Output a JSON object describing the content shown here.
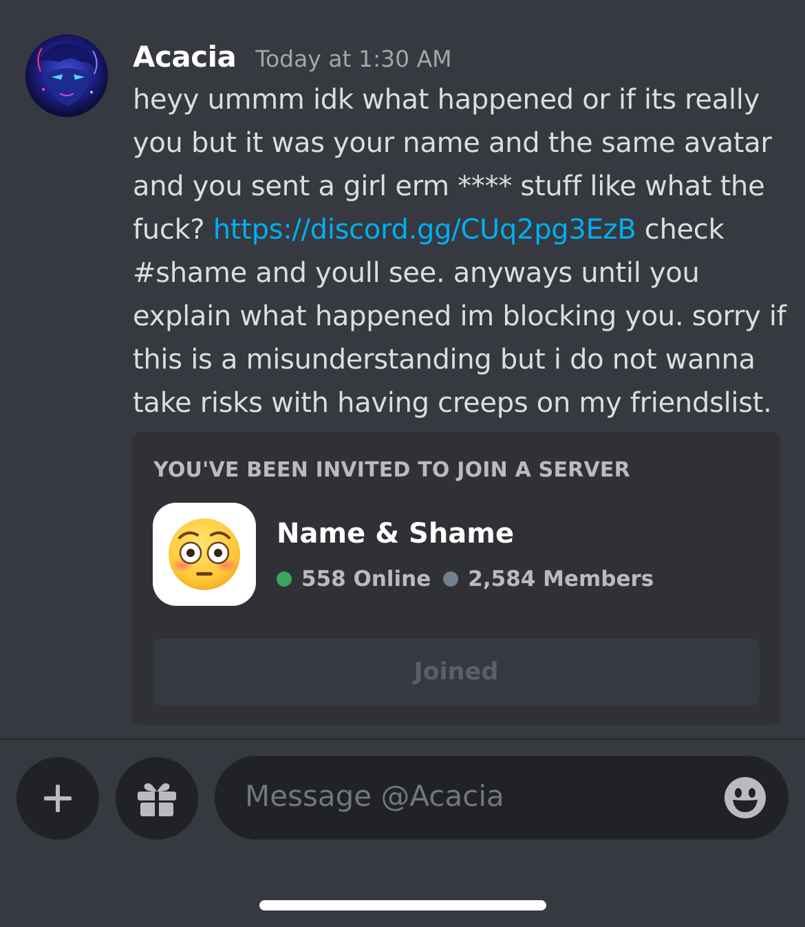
{
  "message": {
    "author": "Acacia",
    "timestamp": "Today at 1:30 AM",
    "text_before_link": "heyy ummm idk what happened or if its really you but it was your name and the same avatar and you sent a girl erm **** stuff like what the fuck? ",
    "link": "https://discord.gg/CUq2pg3EzB",
    "text_after_link": " check #shame and youll see. anyways until you explain what happened im blocking you. sorry if this is a misunderstanding but i do not wanna take risks with having creeps on my friendslist.",
    "avatar_icon": "anime-avatar-icon"
  },
  "invite": {
    "heading": "YOU'VE BEEN INVITED TO JOIN A SERVER",
    "server_name": "Name & Shame",
    "server_icon": "flushed-face-icon",
    "online": "558 Online",
    "members": "2,584 Members",
    "button_label": "Joined"
  },
  "composer": {
    "placeholder": "Message @Acacia",
    "add_icon": "plus-icon",
    "gift_icon": "gift-icon",
    "emoji_icon": "smiley-icon"
  },
  "colors": {
    "background": "#36393f",
    "card": "#2f3136",
    "link": "#00aff4",
    "online": "#3ba55d",
    "members": "#747f8d"
  }
}
